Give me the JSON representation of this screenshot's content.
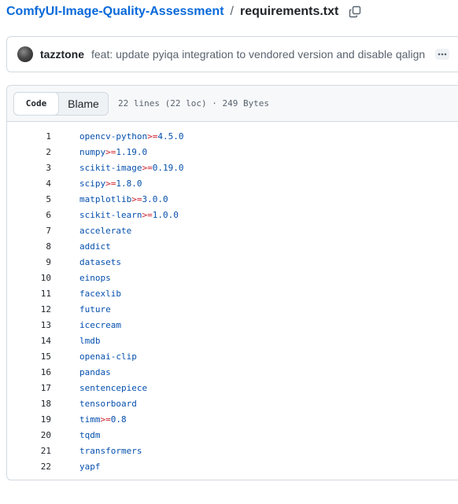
{
  "breadcrumb": {
    "repo": "ComfyUI-Image-Quality-Assessment",
    "separator": "/",
    "file": "requirements.txt"
  },
  "commit": {
    "author": "tazztone",
    "message": "feat: update pyiqa integration to vendored version and disable qalign",
    "more_label": "···"
  },
  "toolbar": {
    "code_label": "Code",
    "blame_label": "Blame",
    "file_info": "22 lines (22 loc) · 249 Bytes"
  },
  "icons": {
    "copy": "copy-icon",
    "more": "kebab-horizontal-icon"
  },
  "colors": {
    "link": "#0969da",
    "package": "#0550ae",
    "operator": "#cf222e"
  },
  "lines": [
    {
      "n": "1",
      "pkg": "opencv-python",
      "op": ">=",
      "ver": "4.5.0"
    },
    {
      "n": "2",
      "pkg": "numpy",
      "op": ">=",
      "ver": "1.19.0"
    },
    {
      "n": "3",
      "pkg": "scikit-image",
      "op": ">=",
      "ver": "0.19.0"
    },
    {
      "n": "4",
      "pkg": "scipy",
      "op": ">=",
      "ver": "1.8.0"
    },
    {
      "n": "5",
      "pkg": "matplotlib",
      "op": ">=",
      "ver": "3.0.0"
    },
    {
      "n": "6",
      "pkg": "scikit-learn",
      "op": ">=",
      "ver": "1.0.0"
    },
    {
      "n": "7",
      "pkg": "accelerate",
      "op": "",
      "ver": ""
    },
    {
      "n": "8",
      "pkg": "addict",
      "op": "",
      "ver": ""
    },
    {
      "n": "9",
      "pkg": "datasets",
      "op": "",
      "ver": ""
    },
    {
      "n": "10",
      "pkg": "einops",
      "op": "",
      "ver": ""
    },
    {
      "n": "11",
      "pkg": "facexlib",
      "op": "",
      "ver": ""
    },
    {
      "n": "12",
      "pkg": "future",
      "op": "",
      "ver": ""
    },
    {
      "n": "13",
      "pkg": "icecream",
      "op": "",
      "ver": ""
    },
    {
      "n": "14",
      "pkg": "lmdb",
      "op": "",
      "ver": ""
    },
    {
      "n": "15",
      "pkg": "openai-clip",
      "op": "",
      "ver": ""
    },
    {
      "n": "16",
      "pkg": "pandas",
      "op": "",
      "ver": ""
    },
    {
      "n": "17",
      "pkg": "sentencepiece",
      "op": "",
      "ver": ""
    },
    {
      "n": "18",
      "pkg": "tensorboard",
      "op": "",
      "ver": ""
    },
    {
      "n": "19",
      "pkg": "timm",
      "op": ">=",
      "ver": "0.8"
    },
    {
      "n": "20",
      "pkg": "tqdm",
      "op": "",
      "ver": ""
    },
    {
      "n": "21",
      "pkg": "transformers",
      "op": "",
      "ver": ""
    },
    {
      "n": "22",
      "pkg": "yapf",
      "op": "",
      "ver": ""
    }
  ]
}
